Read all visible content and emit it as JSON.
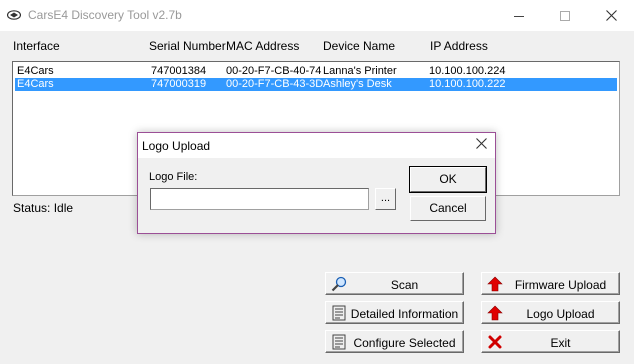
{
  "window": {
    "title": "CarsE4 Discovery Tool v2.7b",
    "controls": {
      "minimize": "—",
      "maximize": "☐",
      "close": "✕"
    }
  },
  "list": {
    "headers": [
      "Interface",
      "Serial Number",
      "MAC Address",
      "Device Name",
      "IP Address"
    ],
    "rows": [
      {
        "interface": "E4Cars",
        "serial": "747001384",
        "mac": "00-20-F7-CB-40-74",
        "name": "Lanna's Printer",
        "ip": "10.100.100.224",
        "selected": false
      },
      {
        "interface": "E4Cars",
        "serial": "747000319",
        "mac": "00-20-F7-CB-43-3D",
        "name": "Ashley's Desk",
        "ip": "10.100.100.222",
        "selected": true
      }
    ]
  },
  "status": "Status: Idle",
  "buttons": {
    "scan": "Scan",
    "detailed": "Detailed Information",
    "configure": "Configure Selected",
    "firmware": "Firmware Upload",
    "logo": "Logo Upload",
    "exit": "Exit"
  },
  "dialog": {
    "title": "Logo Upload",
    "close": "✕",
    "label": "Logo File:",
    "value": "",
    "browse": "...",
    "ok": "OK",
    "cancel": "Cancel"
  },
  "colors": {
    "selection": "#3399ff",
    "dialog_border": "#9b4f96",
    "arrow_red": "#e00000"
  }
}
